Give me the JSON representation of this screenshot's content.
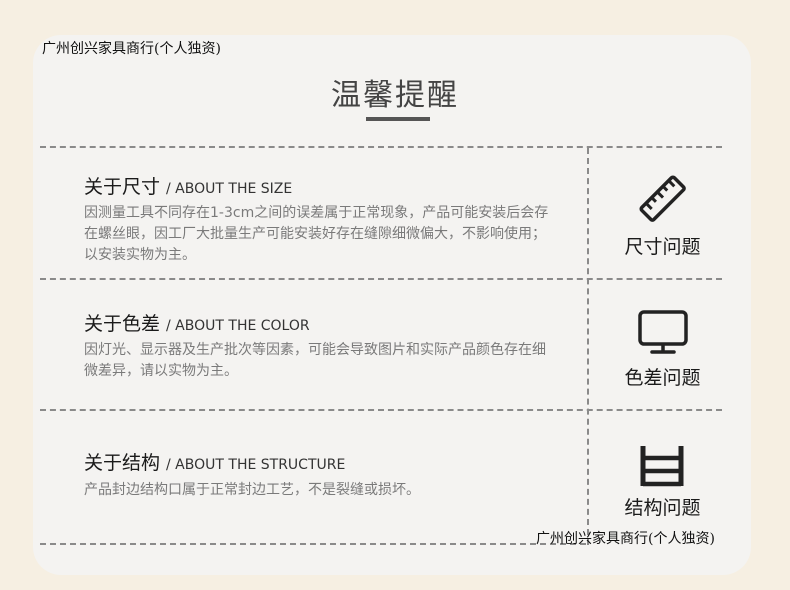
{
  "watermark": "广州创兴家具商行(个人独资)",
  "title": "温馨提醒",
  "sections": [
    {
      "heading_cn": "关于尺寸",
      "heading_en": "/ ABOUT THE SIZE",
      "body": "因测量工具不同存在1-3cm之间的误差属于正常现象，产品可能安装后会存在螺丝眼，因工厂大批量生产可能安装好存在缝隙细微偏大，不影响使用；以安装实物为主。",
      "side_label": "尺寸问题",
      "icon": "ruler-icon"
    },
    {
      "heading_cn": "关于色差",
      "heading_en": "/ ABOUT THE COLOR",
      "body": "因灯光、显示器及生产批次等因素，可能会导致图片和实际产品颜色存在细微差异，请以实物为主。",
      "side_label": "色差问题",
      "icon": "monitor-icon"
    },
    {
      "heading_cn": "关于结构",
      "heading_en": "/ ABOUT THE STRUCTURE",
      "body": "产品封边结构口属于正常封边工艺，不是裂缝或损坏。",
      "side_label": "结构问题",
      "icon": "shelf-structure-icon"
    }
  ]
}
